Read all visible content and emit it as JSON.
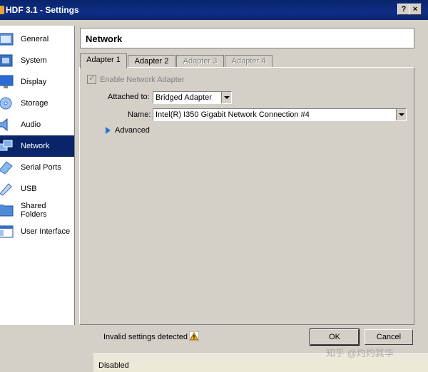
{
  "window": {
    "title": "HDF 3.1 - Settings",
    "help": "?",
    "close": "×"
  },
  "sidebar": {
    "items": [
      {
        "label": "General",
        "icon": "general-icon"
      },
      {
        "label": "System",
        "icon": "system-icon"
      },
      {
        "label": "Display",
        "icon": "display-icon"
      },
      {
        "label": "Storage",
        "icon": "storage-icon"
      },
      {
        "label": "Audio",
        "icon": "audio-icon"
      },
      {
        "label": "Network",
        "icon": "network-icon",
        "selected": true
      },
      {
        "label": "Serial Ports",
        "icon": "serial-ports-icon"
      },
      {
        "label": "USB",
        "icon": "usb-icon"
      },
      {
        "label": "Shared Folders",
        "icon": "shared-folders-icon"
      },
      {
        "label": "User Interface",
        "icon": "user-interface-icon"
      }
    ]
  },
  "page": {
    "title": "Network"
  },
  "tabs": [
    {
      "label": "Adapter 1",
      "active": true
    },
    {
      "label": "Adapter 2"
    },
    {
      "label": "Adapter 3",
      "disabled": true
    },
    {
      "label": "Adapter 4",
      "disabled": true
    }
  ],
  "adapter": {
    "enable_label": "Enable Network Adapter",
    "enable_checked": "✓",
    "attached_label": "Attached to:",
    "attached_value": "Bridged Adapter",
    "name_label": "Name:",
    "name_value": "Intel(R) I350 Gigabit Network Connection #4",
    "advanced_label": "Advanced"
  },
  "footer": {
    "status": "Invalid settings detected",
    "ok": "OK",
    "cancel": "Cancel"
  },
  "background": {
    "disabled_text": "Disabled"
  },
  "watermark": "知乎 @灼灼其华",
  "colors": {
    "selection": "#0a246a",
    "titlebar": "#0a246a",
    "dialog": "#d4d0c8"
  }
}
